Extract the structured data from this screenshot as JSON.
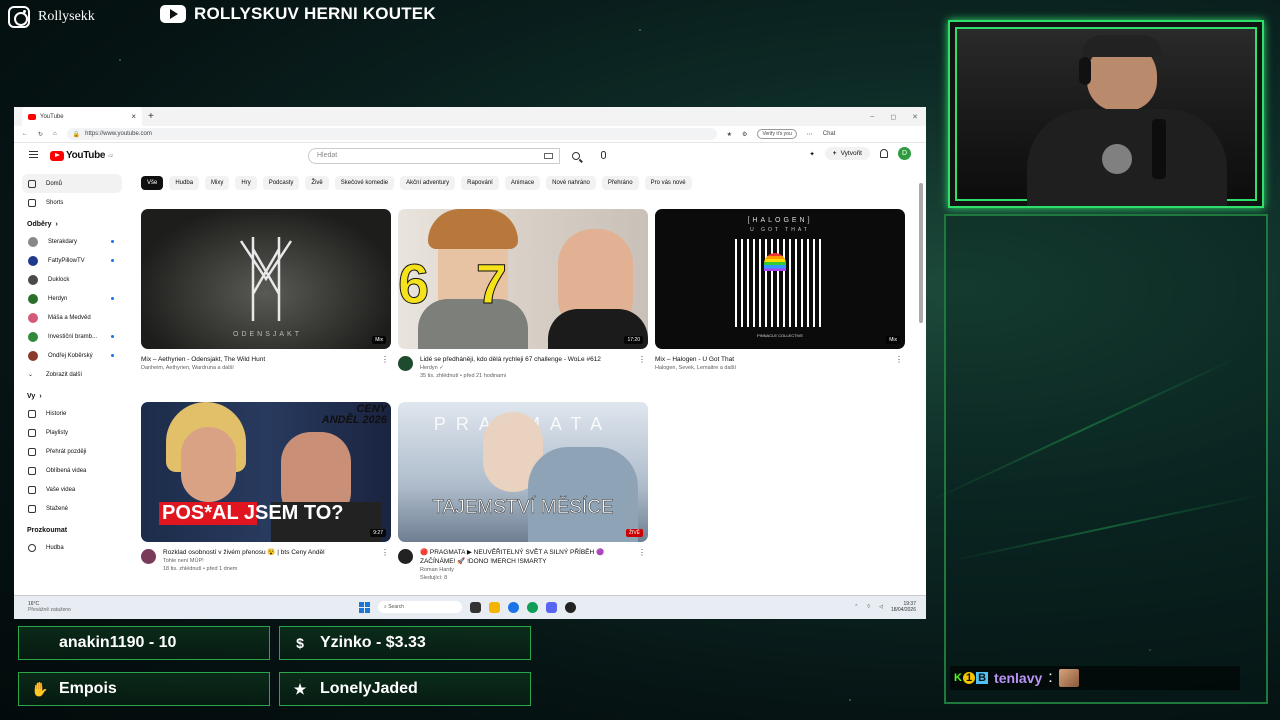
{
  "overlay": {
    "instagram_handle": "Rollysekk",
    "channel_name": "ROLLYSKUV HERNI KOUTEK",
    "alerts": [
      {
        "label": "anakin1190 - 10",
        "icon": "chevron-icon"
      },
      {
        "label": "Yzinko - $3.33",
        "icon": "dollar-icon"
      },
      {
        "label": "Empois",
        "icon": "hand-icon"
      },
      {
        "label": "LonelyJaded",
        "icon": "star-icon"
      }
    ],
    "chat": {
      "user": "tenlavy",
      "separator": ":",
      "badges": [
        "K",
        "1",
        "B"
      ]
    }
  },
  "browser": {
    "tab_title": "YouTube",
    "new_tab": "+",
    "url": "https://www.youtube.com",
    "verify_label": "Verify it's you",
    "chat_label": "Chat",
    "window_controls": [
      "–",
      "◻",
      "✕"
    ]
  },
  "youtube": {
    "logo_text": "YouTube",
    "logo_sup": "CZ",
    "search_placeholder": "Hledat",
    "create_label": "Vytvořit",
    "avatar_letter": "D",
    "sidebar": {
      "main": [
        {
          "label": "Domů",
          "icon": "home-icon"
        },
        {
          "label": "Shorts",
          "icon": "shorts-icon"
        }
      ],
      "subs_header": "Odběry",
      "subs": [
        {
          "label": "Sterakdary",
          "color": "#888888",
          "dot": true
        },
        {
          "label": "FattyPillowTV",
          "color": "#1f3a8a",
          "dot": true
        },
        {
          "label": "Duklock",
          "color": "#4a4a4a",
          "dot": false
        },
        {
          "label": "Herdyn",
          "color": "#2b6e2b",
          "dot": true
        },
        {
          "label": "Máša a Medvěd",
          "color": "#d45a7a",
          "dot": false
        },
        {
          "label": "Investiční bramb...",
          "color": "#2f8a3a",
          "dot": true
        },
        {
          "label": "Ondřej Koběrský",
          "color": "#8a3a2a",
          "dot": true
        }
      ],
      "show_more": "Zobrazit další",
      "you_header": "Vy",
      "you": [
        {
          "label": "Historie",
          "icon": "history-icon"
        },
        {
          "label": "Playlisty",
          "icon": "playlist-icon"
        },
        {
          "label": "Přehrát později",
          "icon": "clock-icon"
        },
        {
          "label": "Oblíbená videa",
          "icon": "like-icon"
        },
        {
          "label": "Vaše videa",
          "icon": "video-icon"
        },
        {
          "label": "Stažené",
          "icon": "download-icon"
        }
      ],
      "explore_header": "Prozkoumat",
      "explore": [
        {
          "label": "Hudba",
          "icon": "music-icon"
        }
      ]
    },
    "chips": [
      "Vše",
      "Hudba",
      "Mixy",
      "Hry",
      "Podcasty",
      "Živě",
      "Skečové komedie",
      "Akční adventury",
      "Rapování",
      "Animace",
      "Nové nahráno",
      "Přehráno",
      "Pro vás nové"
    ],
    "videos": [
      {
        "title": "Mix – Aethyrien - Odensjakt, The Wild Hunt",
        "meta1": "Danheim, Aethyrien, Wardruna a další",
        "meta2": "",
        "badge": "Mix",
        "thumb_text": "ODENSJAKT",
        "has_avatar": false
      },
      {
        "title": "Lidé se předháněji, kdo dělá rychleji 67 challenge - WoLe #612",
        "meta1": "Herdyn ✓",
        "meta2": "35 tis. zhlédnutí • před 21 hodinami",
        "badge": "17:20",
        "thumb_text": "6   7",
        "has_avatar": true
      },
      {
        "title": "Mix – Halogen - U Got That",
        "meta1": "Halogen, Sevek, Lemaitre a další",
        "meta2": "",
        "badge": "Mix",
        "thumb_text": "[HALOGEN]",
        "thumb_sub": "U GOT THAT",
        "thumb_label": "PINNACLE COLLECTIVE",
        "has_avatar": false
      },
      {
        "title": "Rozklad osobností v živém přenosu 😵 | bts Ceny Anděl",
        "meta1": "Tohle není MÚP!",
        "meta2": "18 tis. zhlédnutí • před 1 dnem",
        "badge": "9:27",
        "thumb_text": "POS*AL JSEM TO?",
        "thumb_corner": "CENY ANDĚL 2026",
        "has_avatar": true
      },
      {
        "title": "🔴 PRAGMATA ▶ NEUVĚŘITELNÝ SVĚT A SILNÝ PŘÍBĚH 🟣 ZAČÍNÁME! 🚀 !DONO !MERCH !SMARTY",
        "meta1": "Roman Hardy",
        "meta2": "Sledující: 8",
        "badge": "ŽIVĚ",
        "thumb_text": "TAJEMSTVÍ MĚSÍCE",
        "thumb_top": "PRAGMATA",
        "has_avatar": true
      }
    ]
  },
  "taskbar": {
    "weather_temp": "16°C",
    "weather_desc": "Převážně zataženo",
    "search_label": "Search",
    "time": "19:37",
    "date": "18/04/2026"
  }
}
